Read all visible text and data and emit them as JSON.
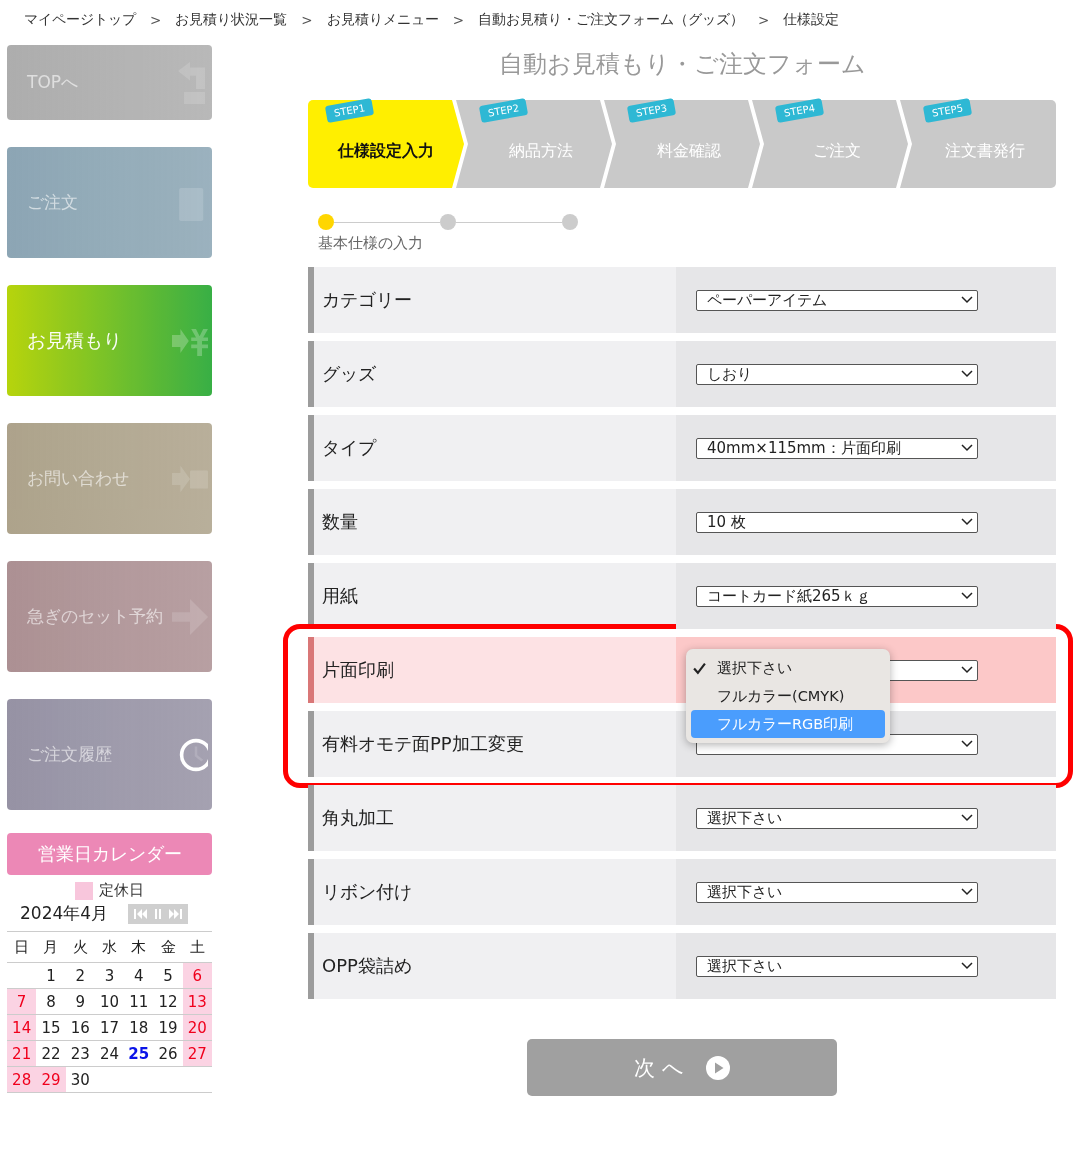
{
  "breadcrumb": [
    {
      "label": "マイページトップ"
    },
    {
      "label": "お見積り状況一覧"
    },
    {
      "label": "お見積りメニュー"
    },
    {
      "label": "自動お見積り・ご注文フォーム（グッズ）"
    },
    {
      "label": "仕様設定"
    }
  ],
  "breadcrumb_separator": ">",
  "sidebar": {
    "items": [
      {
        "label": "TOPへ",
        "kind": "top",
        "color": "#a9a9a9",
        "selected": false
      },
      {
        "label": "ご注文",
        "kind": "order",
        "color": "#86a1b0",
        "selected": false
      },
      {
        "label": "お見積もり",
        "kind": "estimate",
        "color": "#2eab3c",
        "selected": true
      },
      {
        "label": "お問い合わせ",
        "kind": "contact",
        "color": "#a99e85",
        "selected": false
      },
      {
        "label": "急ぎのセット予約",
        "kind": "reserve",
        "color": "#a88b8e",
        "selected": false
      },
      {
        "label": "ご注文履歴",
        "kind": "history",
        "color": "#918da0",
        "selected": false
      }
    ]
  },
  "calendar": {
    "title": "営業日カレンダー",
    "legend": "定休日",
    "month": "2024年4月",
    "weekdays": [
      "日",
      "月",
      "火",
      "水",
      "木",
      "金",
      "土"
    ],
    "weeks": [
      [
        {
          "kind": "blank"
        },
        {
          "kind": "day",
          "day": "1",
          "holiday": false,
          "today": false
        },
        {
          "kind": "day",
          "day": "2",
          "holiday": false,
          "today": false
        },
        {
          "kind": "day",
          "day": "3",
          "holiday": false,
          "today": false
        },
        {
          "kind": "day",
          "day": "4",
          "holiday": false,
          "today": false
        },
        {
          "kind": "day",
          "day": "5",
          "holiday": false,
          "today": false
        },
        {
          "kind": "day",
          "day": "6",
          "holiday": true,
          "today": false
        }
      ],
      [
        {
          "kind": "day",
          "day": "7",
          "holiday": true,
          "today": false
        },
        {
          "kind": "day",
          "day": "8",
          "holiday": false,
          "today": false
        },
        {
          "kind": "day",
          "day": "9",
          "holiday": false,
          "today": false
        },
        {
          "kind": "day",
          "day": "10",
          "holiday": false,
          "today": false
        },
        {
          "kind": "day",
          "day": "11",
          "holiday": false,
          "today": false
        },
        {
          "kind": "day",
          "day": "12",
          "holiday": false,
          "today": false
        },
        {
          "kind": "day",
          "day": "13",
          "holiday": true,
          "today": false
        }
      ],
      [
        {
          "kind": "day",
          "day": "14",
          "holiday": true,
          "today": false
        },
        {
          "kind": "day",
          "day": "15",
          "holiday": false,
          "today": false
        },
        {
          "kind": "day",
          "day": "16",
          "holiday": false,
          "today": false
        },
        {
          "kind": "day",
          "day": "17",
          "holiday": false,
          "today": false
        },
        {
          "kind": "day",
          "day": "18",
          "holiday": false,
          "today": false
        },
        {
          "kind": "day",
          "day": "19",
          "holiday": false,
          "today": false
        },
        {
          "kind": "day",
          "day": "20",
          "holiday": true,
          "today": false
        }
      ],
      [
        {
          "kind": "day",
          "day": "21",
          "holiday": true,
          "today": false
        },
        {
          "kind": "day",
          "day": "22",
          "holiday": false,
          "today": false
        },
        {
          "kind": "day",
          "day": "23",
          "holiday": false,
          "today": false
        },
        {
          "kind": "day",
          "day": "24",
          "holiday": false,
          "today": false
        },
        {
          "kind": "day",
          "day": "25",
          "holiday": false,
          "today": true
        },
        {
          "kind": "day",
          "day": "26",
          "holiday": false,
          "today": false
        },
        {
          "kind": "day",
          "day": "27",
          "holiday": true,
          "today": false
        }
      ],
      [
        {
          "kind": "day",
          "day": "28",
          "holiday": true,
          "today": false
        },
        {
          "kind": "day",
          "day": "29",
          "holiday": true,
          "today": false
        },
        {
          "kind": "day",
          "day": "30",
          "holiday": false,
          "today": false
        },
        {
          "kind": "blank"
        },
        {
          "kind": "blank"
        },
        {
          "kind": "blank"
        },
        {
          "kind": "blank"
        }
      ]
    ]
  },
  "form": {
    "title": "自動お見積もり・ご注文フォーム",
    "steps": [
      {
        "tag": "STEP1",
        "label": "仕様設定入力",
        "selected": true
      },
      {
        "tag": "STEP2",
        "label": "納品方法",
        "selected": false
      },
      {
        "tag": "STEP3",
        "label": "料金確認",
        "selected": false
      },
      {
        "tag": "STEP4",
        "label": "ご注文",
        "selected": false
      },
      {
        "tag": "STEP5",
        "label": "注文書発行",
        "selected": false
      }
    ],
    "progress": {
      "dots": [
        {
          "selected": true
        },
        {
          "selected": false
        },
        {
          "selected": false
        }
      ],
      "caption": "基本仕様の入力"
    },
    "row_groups": [
      {
        "outlined": false,
        "rows": [
          {
            "label": "カテゴリー",
            "value": "ペーパーアイテム",
            "highlighted": false
          },
          {
            "label": "グッズ",
            "value": "しおり",
            "highlighted": false
          },
          {
            "label": "タイプ",
            "value": "40mm×115mm：片面印刷",
            "highlighted": false
          },
          {
            "label": "数量",
            "value": "10 枚",
            "highlighted": false
          },
          {
            "label": "用紙",
            "value": "コートカード紙265ｋｇ",
            "highlighted": false
          }
        ]
      },
      {
        "outlined": true,
        "rows": [
          {
            "label": "片面印刷",
            "highlighted": true,
            "dropdown": [
              {
                "label": "選択下さい",
                "checked": true,
                "selected": false
              },
              {
                "label": "フルカラー(CMYK)",
                "checked": false,
                "selected": false
              },
              {
                "label": "フルカラーRGB印刷",
                "checked": false,
                "selected": true
              }
            ]
          },
          {
            "label": "有料オモテ面PP加工変更",
            "highlighted": false
          }
        ]
      },
      {
        "outlined": false,
        "rows": [
          {
            "label": "角丸加工",
            "value": "選択下さい",
            "highlighted": false
          },
          {
            "label": "リボン付け",
            "value": "選択下さい",
            "highlighted": false
          },
          {
            "label": "OPP袋詰め",
            "value": "選択下さい",
            "highlighted": false
          }
        ]
      }
    ],
    "next_button": "次 へ"
  }
}
